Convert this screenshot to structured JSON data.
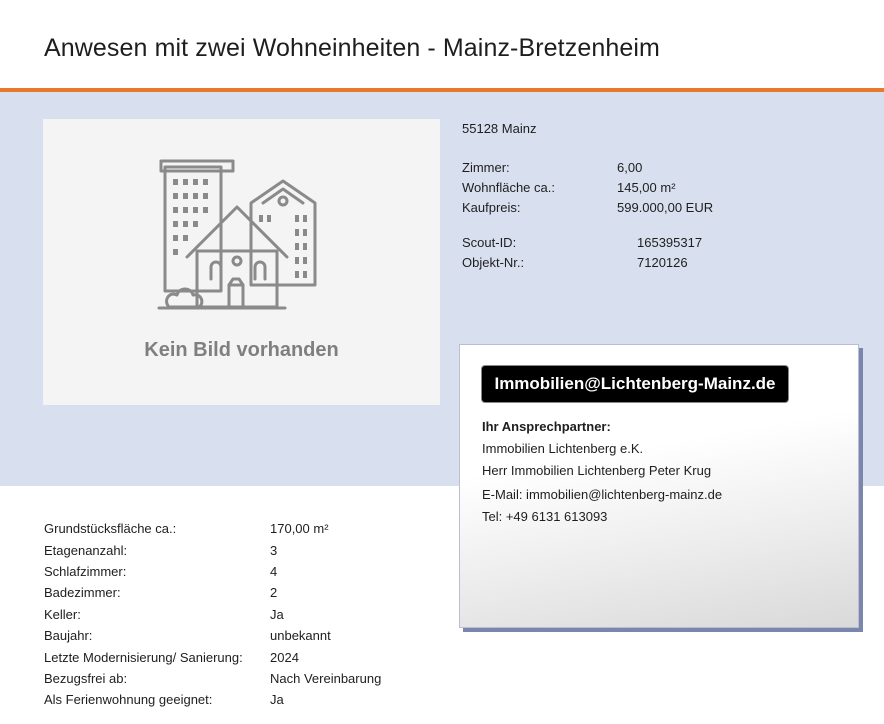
{
  "title": "Anwesen mit zwei Wohneinheiten - Mainz-Bretzenheim",
  "photo": {
    "placeholder_text": "Kein Bild vorhanden",
    "icon": "buildings-house-icon"
  },
  "summary": {
    "location": "55128 Mainz",
    "main_facts": [
      {
        "label": "Zimmer:",
        "value": "6,00"
      },
      {
        "label": "Wohnfläche ca.:",
        "value": "145,00 m²"
      },
      {
        "label": "Kaufpreis:",
        "value": "599.000,00 EUR"
      }
    ],
    "ids": [
      {
        "label": "Scout-ID:",
        "value": "165395317"
      },
      {
        "label": "Objekt-Nr.:",
        "value": "7120126"
      }
    ]
  },
  "contact": {
    "badge": "Immobilien@Lichtenberg-Mainz.de",
    "heading": "Ihr Ansprechpartner:",
    "company": "Immobilien Lichtenberg e.K.",
    "person": "Herr Immobilien Lichtenberg Peter Krug",
    "email": "E-Mail: immobilien@lichtenberg-mainz.de",
    "phone": "Tel: +49 6131 613093"
  },
  "details": [
    {
      "label": "Grundstücksfläche ca.:",
      "value": "170,00 m²"
    },
    {
      "label": "Etagenanzahl:",
      "value": "3"
    },
    {
      "label": "Schlafzimmer:",
      "value": "4"
    },
    {
      "label": "Badezimmer:",
      "value": "2"
    },
    {
      "label": "Keller:",
      "value": "Ja"
    },
    {
      "label": "Baujahr:",
      "value": "unbekannt"
    },
    {
      "label": "Letzte Modernisierung/ Sanierung:",
      "value": "2024"
    },
    {
      "label": "Bezugsfrei ab:",
      "value": "Nach Vereinbarung"
    },
    {
      "label": "Als Ferienwohnung geeignet:",
      "value": "Ja"
    }
  ],
  "colors": {
    "accent": "#e8782c",
    "band": "#d8e0f0",
    "photo_bg": "#f4f4f4"
  }
}
